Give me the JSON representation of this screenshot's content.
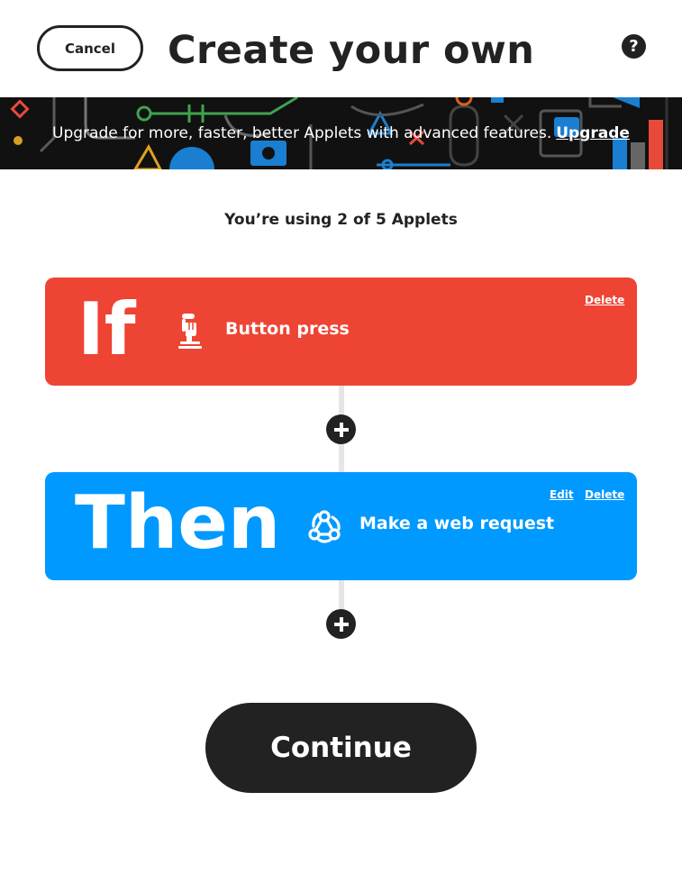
{
  "header": {
    "cancel_label": "Cancel",
    "title": "Create your own",
    "help_label": "?"
  },
  "banner": {
    "text": "Upgrade for more, faster, better Applets with advanced features.",
    "link_label": "Upgrade"
  },
  "usage": {
    "text": "You’re using 2 of 5 Applets"
  },
  "trigger": {
    "keyword": "If",
    "service_label": "Button press",
    "icon": "button-press-icon",
    "delete_label": "Delete",
    "color": "#ee4433"
  },
  "action": {
    "keyword": "Then",
    "service_label": "Make a web request",
    "icon": "webhooks-icon",
    "edit_label": "Edit",
    "delete_label": "Delete",
    "color": "#0099ff"
  },
  "add_icon": "plus-icon",
  "continue_label": "Continue"
}
